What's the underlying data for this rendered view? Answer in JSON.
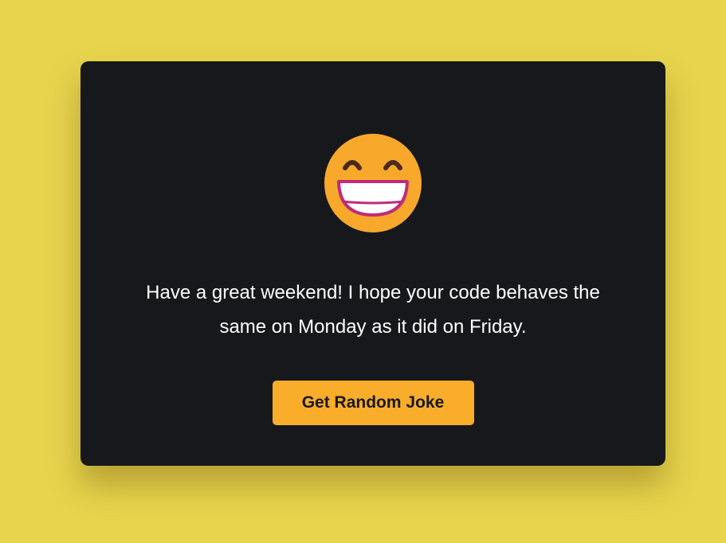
{
  "card": {
    "emoji_icon": "grinning-face-with-smiling-eyes-icon",
    "joke_text": "Have a great weekend! I hope your code behaves the same on Monday as it did on Friday.",
    "button_label": "Get Random Joke"
  },
  "colors": {
    "background": "#e8d44d",
    "card": "#17181c",
    "button": "#f9ad2a",
    "text": "#ffffff"
  }
}
